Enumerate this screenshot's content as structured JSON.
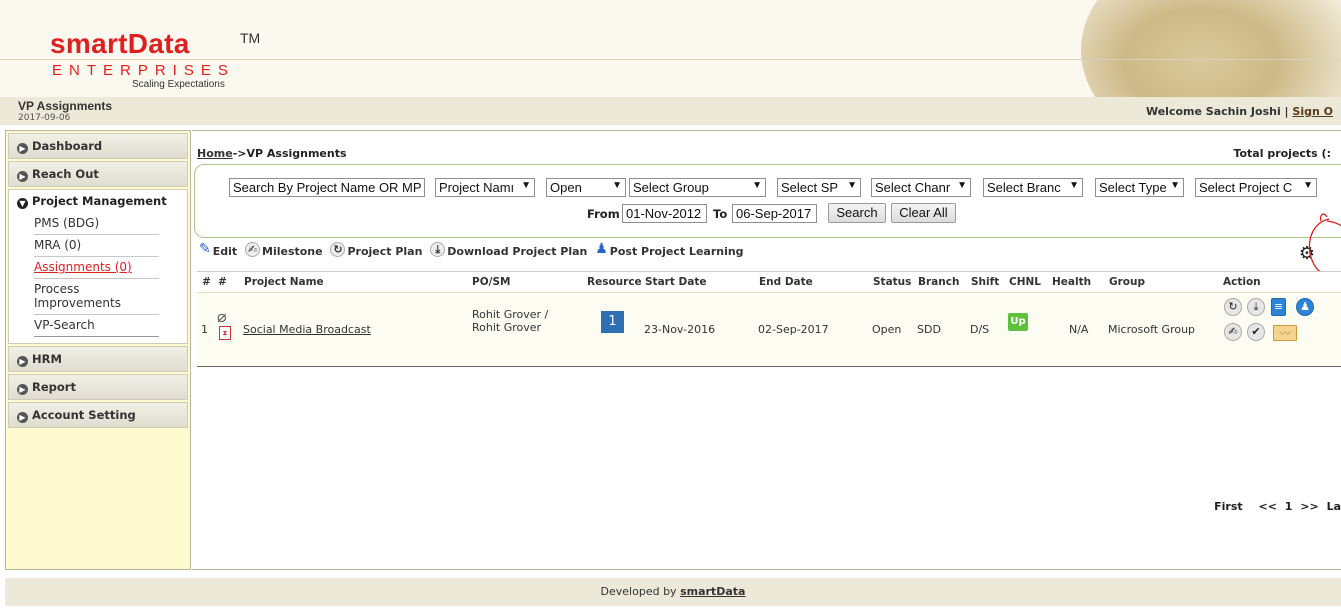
{
  "header": {
    "brand": "smartData",
    "trademark": "TM",
    "brand_sub": "ENTERPRISES",
    "tagline": "Scaling Expectations"
  },
  "titlebar": {
    "title": "VP Assignments",
    "date": "2017-09-06",
    "welcome": "Welcome Sachin Joshi |",
    "signout": "Sign O"
  },
  "sidebar": {
    "items": [
      {
        "label": "Dashboard"
      },
      {
        "label": "Reach Out"
      }
    ],
    "open_section": {
      "label": "Project Management",
      "subitems": [
        {
          "label": "PMS (BDG)"
        },
        {
          "label": "MRA (0)"
        },
        {
          "label": "Assignments (0)"
        },
        {
          "label": "Process Improvements"
        },
        {
          "label": "VP-Search"
        }
      ]
    },
    "items_after": [
      {
        "label": "HRM"
      },
      {
        "label": "Report"
      },
      {
        "label": "Account Setting"
      }
    ]
  },
  "breadcrumb": {
    "home": "Home",
    "sep": "->",
    "current": "VP Assignments"
  },
  "total_projects": "Total projects (:",
  "filters": {
    "search_placeholder": "Search By Project Name OR MP",
    "project_name": "Project Namı",
    "status": "Open",
    "group": "Select Group",
    "sp": "Select SP",
    "channel": "Select Chanr",
    "branch": "Select Branc",
    "type": "Select Type",
    "project_c": "Select Project C",
    "from_label": "From",
    "from_value": "01-Nov-2012",
    "to_label": "To",
    "to_value": "06-Sep-2017",
    "search_button": "Search",
    "clear_button": "Clear All"
  },
  "toolbar": {
    "edit": "Edit",
    "milestone": "Milestone",
    "project_plan": "Project Plan",
    "download": "Download Project Plan",
    "post_learning": "Post Project Learning"
  },
  "table": {
    "headers": [
      "#",
      "#",
      "Project Name",
      "PO/SM",
      "Resource",
      "Start Date",
      "End Date",
      "Status",
      "Branch",
      "Shift",
      "CHNL",
      "Health",
      "Group",
      "Action"
    ],
    "rows": [
      {
        "index": "1",
        "project_name": "Social Media Broadcast",
        "po_sm_line1": "Rohit Grover /",
        "po_sm_line2": "Rohit Grover",
        "resource": "1",
        "start_date": "23-Nov-2016",
        "end_date": "02-Sep-2017",
        "status": "Open",
        "branch": "SDD",
        "shift": "D/S",
        "chnl": "Up",
        "health": "N/A",
        "group": "Microsoft Group"
      }
    ]
  },
  "pager": {
    "first": "First",
    "prev": "<<",
    "page": "1",
    "next": ">>",
    "last": "La"
  },
  "footer": {
    "prefix": "Developed by",
    "link": "smartData"
  },
  "colors": {
    "brand_red": "#e02020",
    "resource_blue": "#2e6fb4",
    "chnl_green": "#5ec03b",
    "sidebar_bg": "#fffbd0"
  }
}
